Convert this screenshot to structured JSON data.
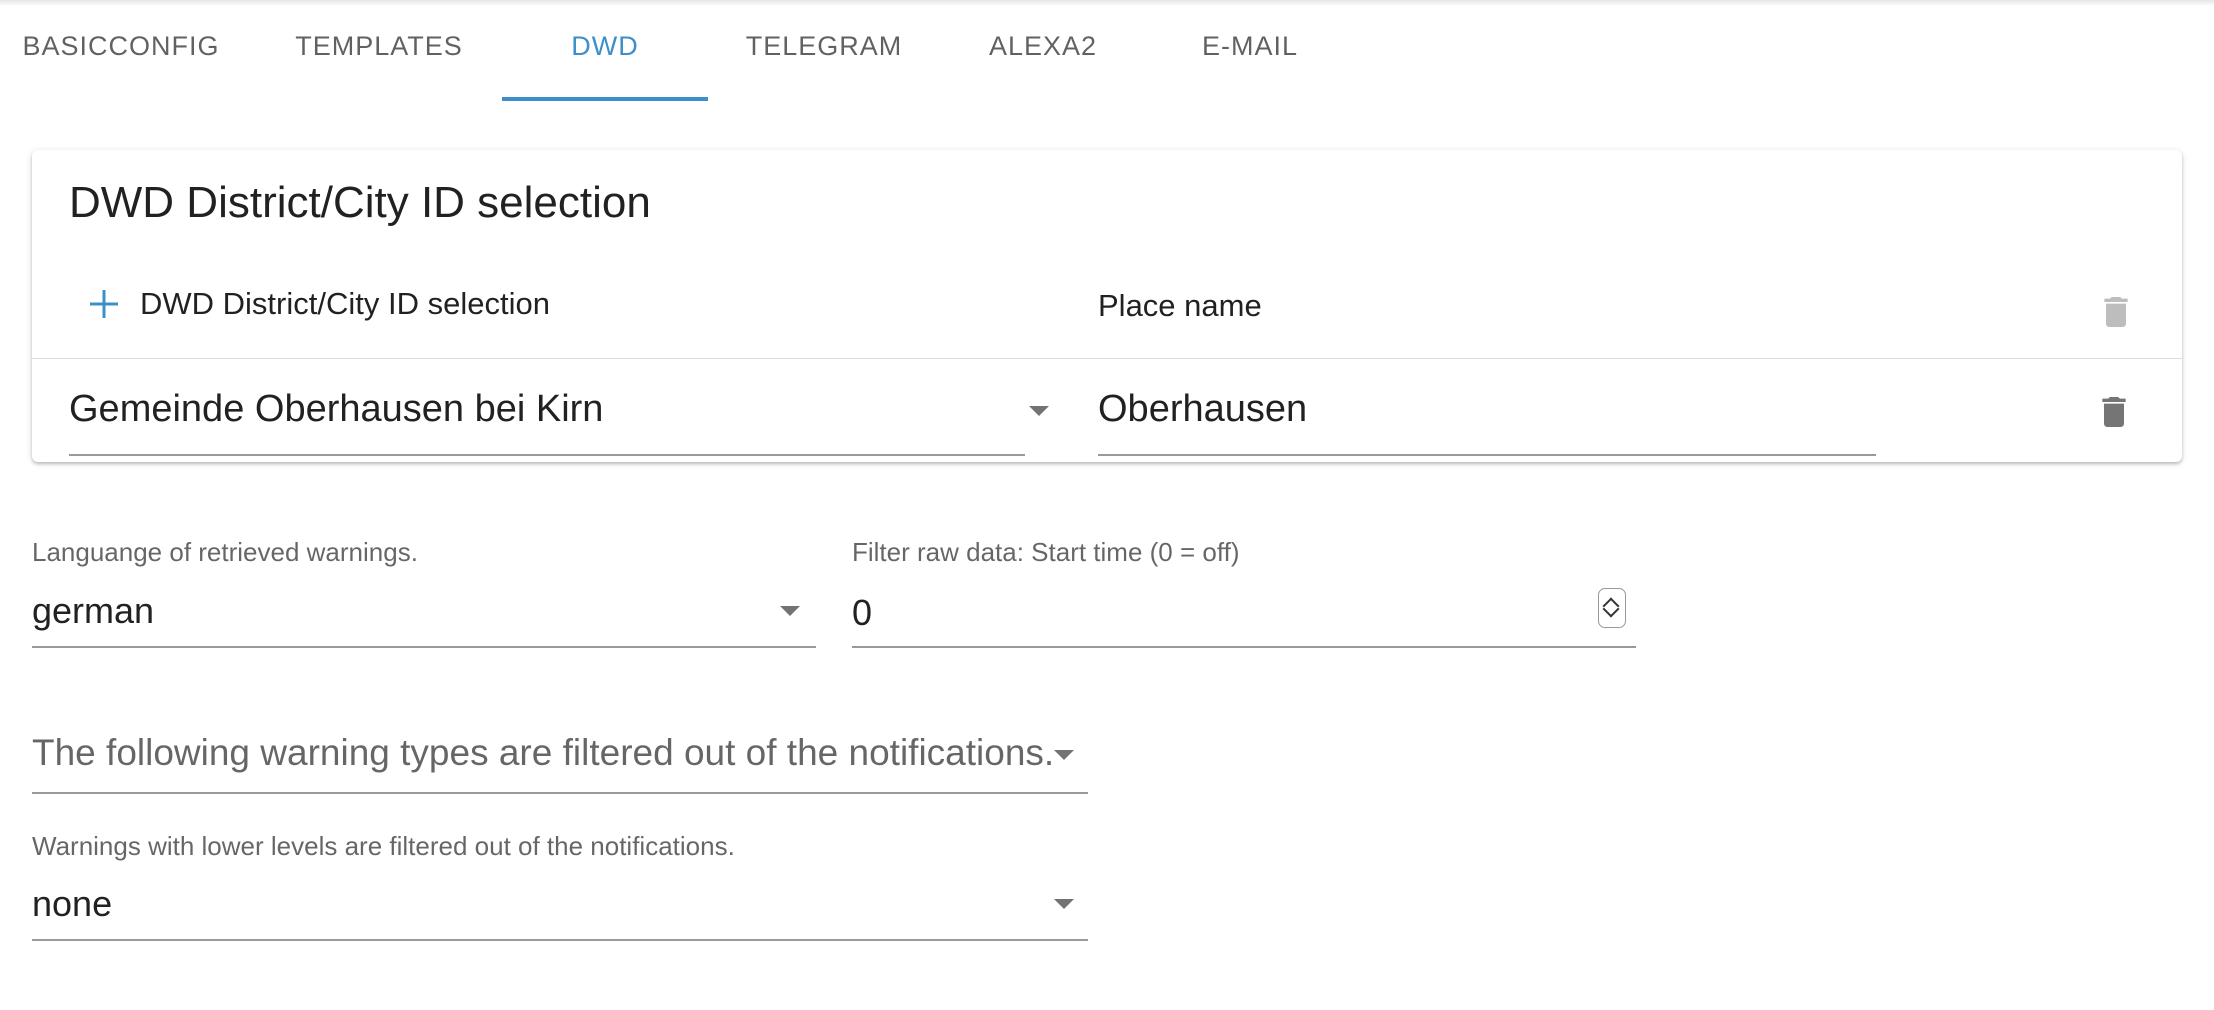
{
  "tabs": [
    {
      "label": "BASICCONFIG",
      "active": false
    },
    {
      "label": "TEMPLATES",
      "active": false
    },
    {
      "label": "DWD",
      "active": true
    },
    {
      "label": "TELEGRAM",
      "active": false
    },
    {
      "label": "ALEXA2",
      "active": false
    },
    {
      "label": "E-MAIL",
      "active": false
    }
  ],
  "colors": {
    "accent": "#3d8fc9",
    "text": "#212121",
    "muted": "#666666",
    "icon": "#757575",
    "icon_disabled": "#bdbdbd"
  },
  "table": {
    "title": "DWD District/City ID selection",
    "add_icon": "plus-icon",
    "columns": [
      "DWD District/City ID selection",
      "Place name"
    ],
    "rows": [
      {
        "district": "Gemeinde Oberhausen bei Kirn",
        "place": "Oberhausen"
      }
    ]
  },
  "language": {
    "label": "Languange of retrieved warnings.",
    "value": "german"
  },
  "filter_start": {
    "label": "Filter raw data: Start time (0 = off)",
    "value": "0"
  },
  "warning_types": {
    "placeholder": "The following warning types are filtered out of the notifications."
  },
  "warning_level": {
    "label": "Warnings with lower levels are filtered out of the notifications.",
    "value": "none"
  }
}
